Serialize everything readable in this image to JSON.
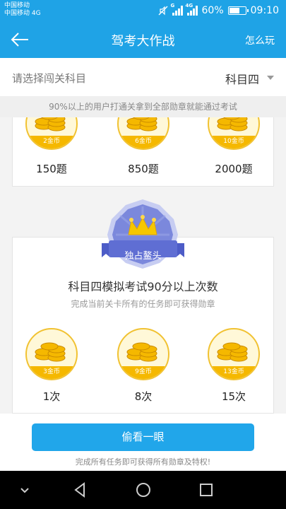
{
  "status_bar": {
    "carrier_1": "中国移动",
    "carrier_2": "中国移动 4G",
    "network_1": "G",
    "network_2": "4G",
    "battery": "60%",
    "battery_level": 0.6,
    "time": "09:10"
  },
  "header": {
    "title": "驾考大作战",
    "how_to_play": "怎么玩"
  },
  "subject": {
    "label": "请选择闯关科目",
    "value": "科目四"
  },
  "tip": "90%以上的用户打通关拿到全部勋章就能通过考试",
  "card1": {
    "rewards": [
      {
        "coins": "2金币",
        "value": "150题"
      },
      {
        "coins": "6金币",
        "value": "850题"
      },
      {
        "coins": "10金币",
        "value": "2000题"
      }
    ]
  },
  "card2": {
    "badge": "独占鳌头",
    "title": "科目四模拟考试90分以上次数",
    "subtitle": "完成当前关卡所有的任务即可获得勋章",
    "rewards": [
      {
        "coins": "3金币",
        "value": "1次"
      },
      {
        "coins": "9金币",
        "value": "8次"
      },
      {
        "coins": "13金币",
        "value": "15次"
      }
    ]
  },
  "bottom": {
    "button": "偷看一眼",
    "note": "完成所有任务即可获得所有勋章及特权!"
  },
  "colors": {
    "primary": "#1fa3e6",
    "button": "#21a6ea",
    "coin": "#f5b800",
    "badge": "#6f7dd6"
  }
}
